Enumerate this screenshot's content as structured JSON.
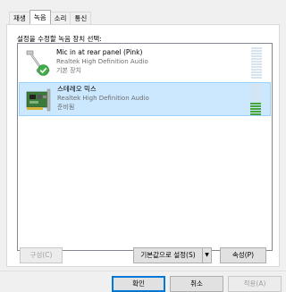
{
  "tabs": [
    {
      "label": "재생"
    },
    {
      "label": "녹음"
    },
    {
      "label": "소리"
    },
    {
      "label": "통신"
    }
  ],
  "instruction": "설정을 수정할 녹음 장치 선택:",
  "devices": [
    {
      "name": "Mic in at rear panel (Pink)",
      "description": "Realtek High Definition Audio",
      "status": "기본 장치",
      "icon": "microphone-icon",
      "badge": "default-check-icon",
      "level_fraction": 0
    },
    {
      "name": "스테레오 믹스",
      "description": "Realtek High Definition Audio",
      "status": "준비됨",
      "icon": "sound-card-icon",
      "level_fraction": 0.4
    }
  ],
  "buttons": {
    "configure": "구성(C)",
    "set_default": "기본값으로 설정(S)",
    "properties": "속성(P)",
    "ok": "확인",
    "cancel": "취소",
    "apply": "적용(A)"
  },
  "colors": {
    "selection_bg": "#cce8ff",
    "selection_border": "#99d1ff",
    "meter_lit": "#48a43e",
    "meter_dim": "#d7e4ef",
    "check_green": "#3fae49"
  }
}
